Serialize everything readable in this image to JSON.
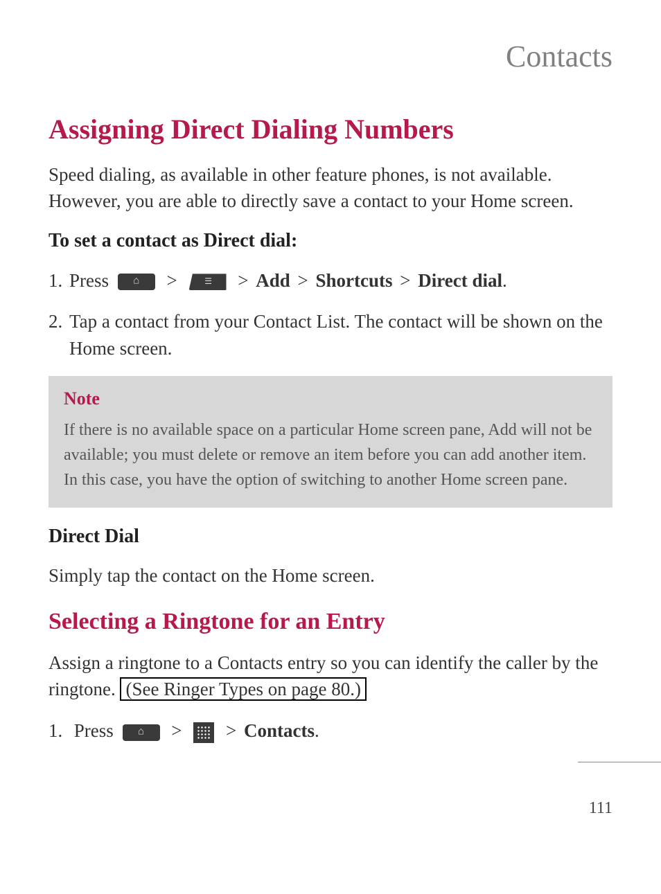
{
  "chapter_title": "Contacts",
  "section1": {
    "title": "Assigning Direct Dialing Numbers",
    "intro": "Speed dialing, as available in other feature phones, is not available. However, you are able to directly save a contact to your Home screen.",
    "subheading": "To set a contact as Direct dial:",
    "step1": {
      "num": "1.",
      "press": "Press",
      "add": "Add",
      "shortcuts": "Shortcuts",
      "direct_dial": "Direct dial",
      "gt": ">",
      "period": "."
    },
    "step2": {
      "num": "2.",
      "text": "Tap a contact from your Contact List. The contact will be shown on the Home screen."
    },
    "note": {
      "title": "Note",
      "text": "If there is no available space on a particular Home screen pane, Add will not be available; you must delete or remove an item before you can add another item. In this case, you have the option of switching to another Home screen pane."
    },
    "direct_dial_heading": "Direct Dial",
    "direct_dial_text": "Simply tap the contact on the Home screen."
  },
  "section2": {
    "title": "Selecting a Ringtone for an Entry",
    "intro_part1": "Assign a ringtone to a Contacts entry so you can identify the caller by the ringtone. ",
    "link_text": "(See Ringer Types on page 80.)",
    "step1": {
      "num": "1.",
      "press": "Press",
      "gt": ">",
      "contacts": "Contacts",
      "period": "."
    }
  },
  "page_number": "111"
}
